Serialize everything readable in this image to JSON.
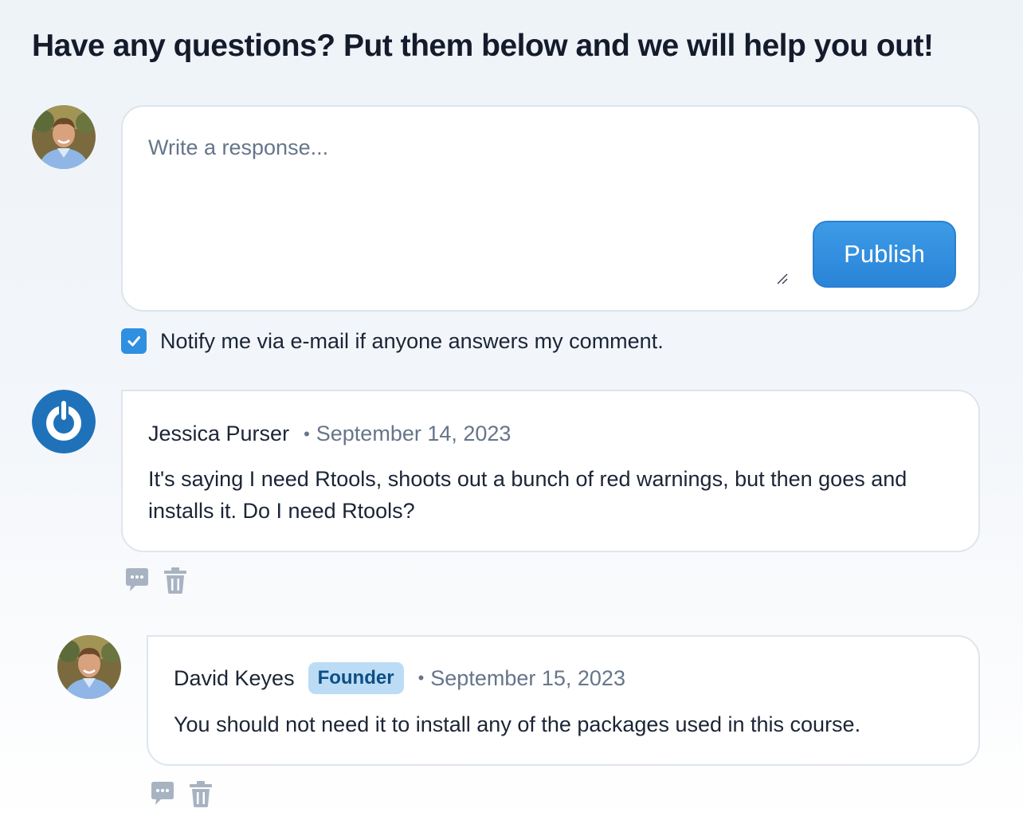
{
  "heading": "Have any questions? Put them below and we will help you out!",
  "composer": {
    "placeholder": "Write a response...",
    "value": "",
    "publish_label": "Publish"
  },
  "notify": {
    "label": "Notify me via e-mail if anyone answers my comment.",
    "checked": true
  },
  "comments": [
    {
      "author": "Jessica Purser",
      "date": "September 14, 2023",
      "body": "It's saying I need Rtools, shoots out a bunch of red warnings, but then goes and installs it. Do I need Rtools?",
      "avatar_icon": "power-logo-icon",
      "replies": [
        {
          "author": "David Keyes",
          "badge": "Founder",
          "date": "September 15, 2023",
          "body": "You should not need it to install any of the packages used in this course.",
          "avatar_icon": "user-photo"
        }
      ]
    }
  ],
  "colors": {
    "accent": "#2f8fe0",
    "badge_bg": "#bcdcf5",
    "badge_text": "#0d4f85",
    "muted_text": "#66758a",
    "icon_gray": "#a8b3c2"
  }
}
